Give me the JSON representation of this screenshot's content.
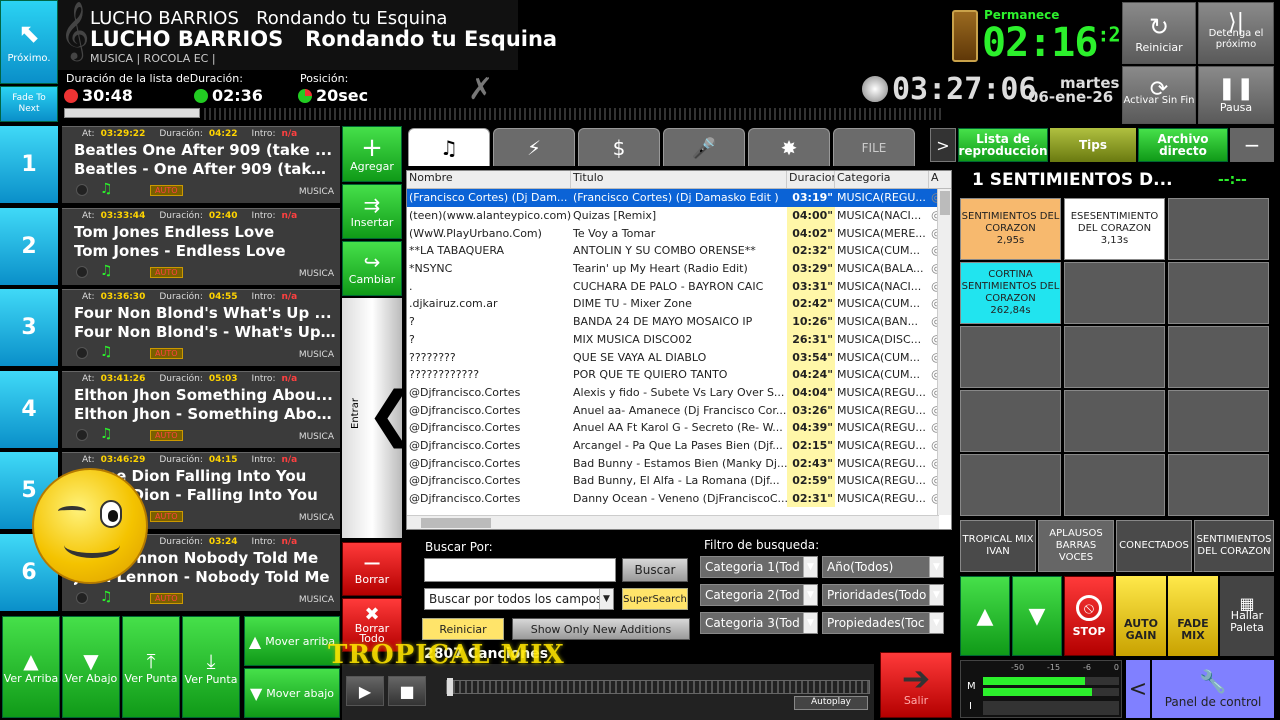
{
  "header": {
    "proximo_label": "Próximo.",
    "fade_label": "Fade To Next",
    "artist_small": "LUCHO BARRIOS",
    "title_small": "Rondando tu Esquina",
    "artist_big": "LUCHO BARRIOS",
    "title_big": "Rondando tu Esquina",
    "tags": "MUSICA | ROCOLA EC |",
    "dur_lista_label": "Duración de la lista de",
    "dur_label": "Duración:",
    "pos_label": "Posición:",
    "dur_lista_val": "30:48",
    "dur_val": "02:36",
    "pos_val": "20sec",
    "permanece_label": "Permanece",
    "permanece_val": "02:16",
    "permanece_sup": ":2",
    "clock": "03:27:06",
    "day": "martes",
    "date": "06-ene-26",
    "reiniciar": "Reiniciar",
    "detenga": "Detenga el próximo",
    "activar": "Activar Sin Fin",
    "pausa": "Pausa"
  },
  "queue": [
    {
      "num": "1",
      "at": "03:29:22",
      "dur": "04:22",
      "intro": "n/a",
      "l1": "Beatles   One After 909 (take ...",
      "l2": "Beatles - One After 909 (take ...",
      "cat": "MUSICA"
    },
    {
      "num": "2",
      "at": "03:33:44",
      "dur": "02:40",
      "intro": "n/a",
      "l1": "Tom Jones   Endless Love",
      "l2": "Tom Jones - Endless Love",
      "cat": "MUSICA"
    },
    {
      "num": "3",
      "at": "03:36:30",
      "dur": "04:55",
      "intro": "n/a",
      "l1": "Four Non Blond's   What's Up ...",
      "l2": "Four Non Blond's - What's Up ...",
      "cat": "MUSICA"
    },
    {
      "num": "4",
      "at": "03:41:26",
      "dur": "05:03",
      "intro": "n/a",
      "l1": "Elthon Jhon   Something Abou...",
      "l2": "Elthon Jhon - Something Abou...",
      "cat": "MUSICA"
    },
    {
      "num": "5",
      "at": "03:46:29",
      "dur": "04:15",
      "intro": "n/a",
      "l1": "Celine Dion   Falling Into You",
      "l2": "Celine Dion - Falling Into You",
      "cat": "MUSICA"
    },
    {
      "num": "6",
      "at": "03:50:44",
      "dur": "03:24",
      "intro": "n/a",
      "l1": "John Lennon   Nobody Told Me",
      "l2": "John Lennon - Nobody Told Me",
      "cat": "MUSICA"
    }
  ],
  "queue_meta_labels": {
    "at": "At:",
    "dur": "Duración:",
    "intro": "Intro:",
    "auto": "AUTO"
  },
  "side_buttons": {
    "agregar": "Agregar",
    "insertar": "Insertar",
    "cambiar": "Cambiar",
    "entrar": "Entrar",
    "borrar": "Borrar",
    "borrar_todo": "Borrar Todo"
  },
  "tabs": [
    "♫",
    "⚡",
    "$",
    "🎤",
    "✸",
    "FILE"
  ],
  "list_columns": [
    "Nombre",
    "Titulo",
    "Duracion",
    "Categoria",
    "A"
  ],
  "list_rows": [
    [
      "(Francisco Cortes) (Dj Dam...",
      "(Francisco Cortes) (Dj Damasko Edit )",
      "03:19\"",
      "MUSICA(REGU..."
    ],
    [
      "(teen)(www.alanteypico.com)",
      "Quizas [Remix]",
      "04:00\"",
      "MUSICA(NACI..."
    ],
    [
      "(WwW.PlayUrbano.Com)",
      "Te Voy a Tomar",
      "04:02\"",
      "MUSICA(MERE..."
    ],
    [
      "**LA TABAQUERA",
      "ANTOLIN Y SU COMBO ORENSE**",
      "02:32\"",
      "MUSICA(CUM..."
    ],
    [
      "*NSYNC",
      "Tearin' up My Heart (Radio Edit)",
      "03:29\"",
      "MUSICA(BALA..."
    ],
    [
      ".",
      "CUCHARA DE PALO - BAYRON CAIC",
      "03:31\"",
      "MUSICA(NACI..."
    ],
    [
      ".djkairuz.com.ar",
      "DIME TU - Mixer Zone",
      "02:42\"",
      "MUSICA(CUM..."
    ],
    [
      "?",
      "BANDA 24 DE MAYO MOSAICO IP",
      "10:26\"",
      "MUSICA(BAN..."
    ],
    [
      "?",
      "MIX MUSICA DISCO02",
      "26:31\"",
      "MUSICA(DISC..."
    ],
    [
      "????????",
      "QUE SE VAYA AL DIABLO",
      "03:54\"",
      "MUSICA(CUM..."
    ],
    [
      "????????????",
      "POR QUE TE QUIERO TANTO",
      "04:24\"",
      "MUSICA(CUM..."
    ],
    [
      "@Djfrancisco.Cortes",
      "Alexis y fido - Subete Vs Lary Over S...",
      "04:04\"",
      "MUSICA(REGU..."
    ],
    [
      "@Djfrancisco.Cortes",
      "Anuel aa- Amanece (Dj Francisco Cor...",
      "03:26\"",
      "MUSICA(REGU..."
    ],
    [
      "@Djfrancisco.Cortes",
      "Anuel AA Ft Karol G - Secreto (Re- W...",
      "04:39\"",
      "MUSICA(REGU..."
    ],
    [
      "@Djfrancisco.Cortes",
      "Arcangel - Pa Que La Pases Bien (Djf...",
      "02:15\"",
      "MUSICA(REGU..."
    ],
    [
      "@Djfrancisco.Cortes",
      "Bad Bunny - Estamos Bien (Manky Dj...",
      "02:43\"",
      "MUSICA(REGU..."
    ],
    [
      "@Djfrancisco.Cortes",
      "Bad Bunny, El Alfa - La Romana (Djf...",
      "02:59\"",
      "MUSICA(REGU..."
    ],
    [
      "@Djfrancisco.Cortes",
      "Danny Ocean - Veneno (DjFranciscoC...",
      "02:31\"",
      "MUSICA(REGU..."
    ]
  ],
  "search": {
    "buscar_por": "Buscar Por:",
    "input_value": "",
    "buscar_btn": "Buscar",
    "mode": "Buscar por todos los campos",
    "supersearch": "SuperSearch",
    "reiniciar": "Reiniciar",
    "show_only": "Show Only New Additions",
    "count": "2807 Canciones",
    "filtro": "Filtro de busqueda:",
    "cat1": "Categoria 1(Tod",
    "cat2": "Categoria 2(Tod",
    "cat3": "Categoria 3(Tod",
    "anio": "Año(Todos)",
    "prioridades": "Prioridades(Todo",
    "propiedades": "Propiedades(Toc"
  },
  "bottom": {
    "ver_arriba": "Ver Arriba",
    "ver_abajo": "Ver Abajo",
    "ver_punta": "Ver Punta",
    "ver_punta2": "Ver Punta",
    "mover_arriba": "Mover arriba",
    "mover_abajo": "Mover abajo",
    "banner": "TROPICAL MIX",
    "autoplay": "Autoplay",
    "salir": "Salir"
  },
  "right": {
    "lista": "Lista de reproducción",
    "tips": "Tips",
    "archivo": "Archivo directo",
    "palette_title": "1  SENTIMIENTOS D...",
    "palette_time": "--:--",
    "pal1_name": "SENTIMIENTOS DEL CORAZON",
    "pal1_time": "2,95s",
    "pal2_name": "ESESENTIMIENTO DEL CORAZON",
    "pal2_time": "3,13s",
    "pal3_name": "CORTINA SENTIMIENTOS DEL CORAZON",
    "pal3_time": "262,84s",
    "tab1": "TROPICAL MIX IVAN",
    "tab2": "APLAUSOS BARRAS VOCES",
    "tab3": "CONECTADOS",
    "tab4": "SENTIMIENTOS DEL CORAZON",
    "stop": "STOP",
    "auto_gain": "AUTO GAIN",
    "fade_mix": "FADE MIX",
    "hallar": "Hallar Paleta",
    "vu_labels": [
      "-50",
      "-15",
      "-6",
      "0"
    ],
    "panel": "Panel de control",
    "m": "M",
    "i": "I"
  },
  "colors": {
    "accent_green": "#2cf02c",
    "accent_cyan": "#21c4ef",
    "selected_row": "#0b63d6"
  }
}
